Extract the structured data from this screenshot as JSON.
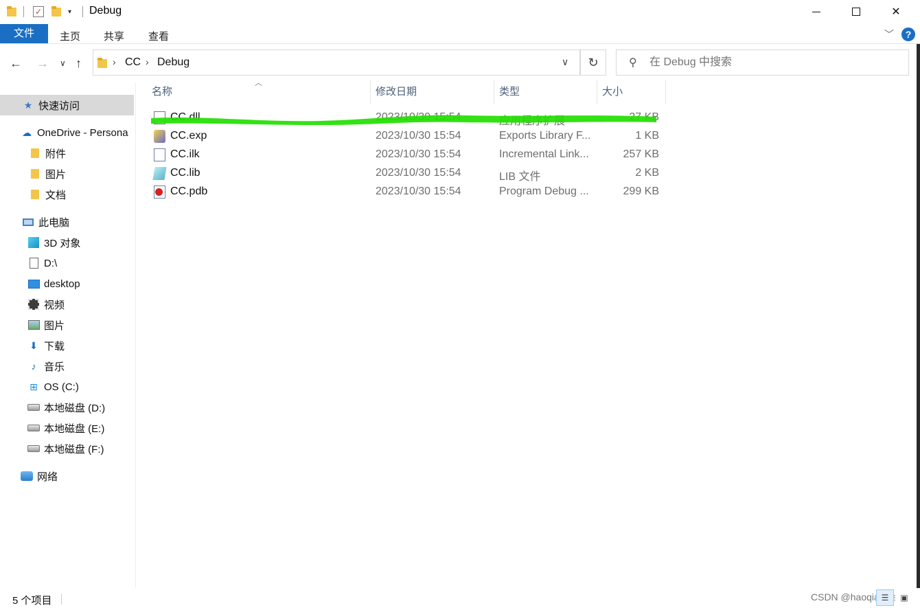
{
  "window": {
    "title": "Debug",
    "minimize_label": "",
    "maximize_label": "",
    "close_label": "✕"
  },
  "ribbon": {
    "file_tab": "文件",
    "tabs": [
      "主页",
      "共享",
      "查看"
    ],
    "help": "?"
  },
  "nav": {
    "breadcrumb": [
      "CC",
      "Debug"
    ],
    "search_placeholder": "在 Debug 中搜索"
  },
  "sidebar": {
    "quick_access": "快速访问",
    "onedrive": "OneDrive - Persona",
    "onedrive_children": [
      "附件",
      "图片",
      "文档"
    ],
    "this_pc": "此电脑",
    "pc_children": [
      "3D 对象",
      "D:\\",
      "desktop",
      "视频",
      "图片",
      "下载",
      "音乐",
      "OS (C:)",
      "本地磁盘 (D:)",
      "本地磁盘 (E:)",
      "本地磁盘 (F:)"
    ],
    "network": "网络"
  },
  "columns": {
    "name": "名称",
    "modified": "修改日期",
    "type": "类型",
    "size": "大小"
  },
  "files": [
    {
      "name": "CC.dll",
      "modified": "2023/10/30 15:54",
      "type": "应用程序扩展",
      "size": "27 KB",
      "icon": "dll-file-icon"
    },
    {
      "name": "CC.exp",
      "modified": "2023/10/30 15:54",
      "type": "Exports Library F...",
      "size": "1 KB",
      "icon": "exp-file-icon"
    },
    {
      "name": "CC.ilk",
      "modified": "2023/10/30 15:54",
      "type": "Incremental Link...",
      "size": "257 KB",
      "icon": "ilk-file-icon"
    },
    {
      "name": "CC.lib",
      "modified": "2023/10/30 15:54",
      "type": "LIB 文件",
      "size": "2 KB",
      "icon": "lib-file-icon"
    },
    {
      "name": "CC.pdb",
      "modified": "2023/10/30 15:54",
      "type": "Program Debug ...",
      "size": "299 KB",
      "icon": "pdb-file-icon"
    }
  ],
  "status": {
    "count": "5 个项目",
    "watermark": "CSDN @haoqiaoqiao"
  },
  "colors": {
    "accent": "#1a6fc4",
    "highlight_marker": "#22e000"
  }
}
